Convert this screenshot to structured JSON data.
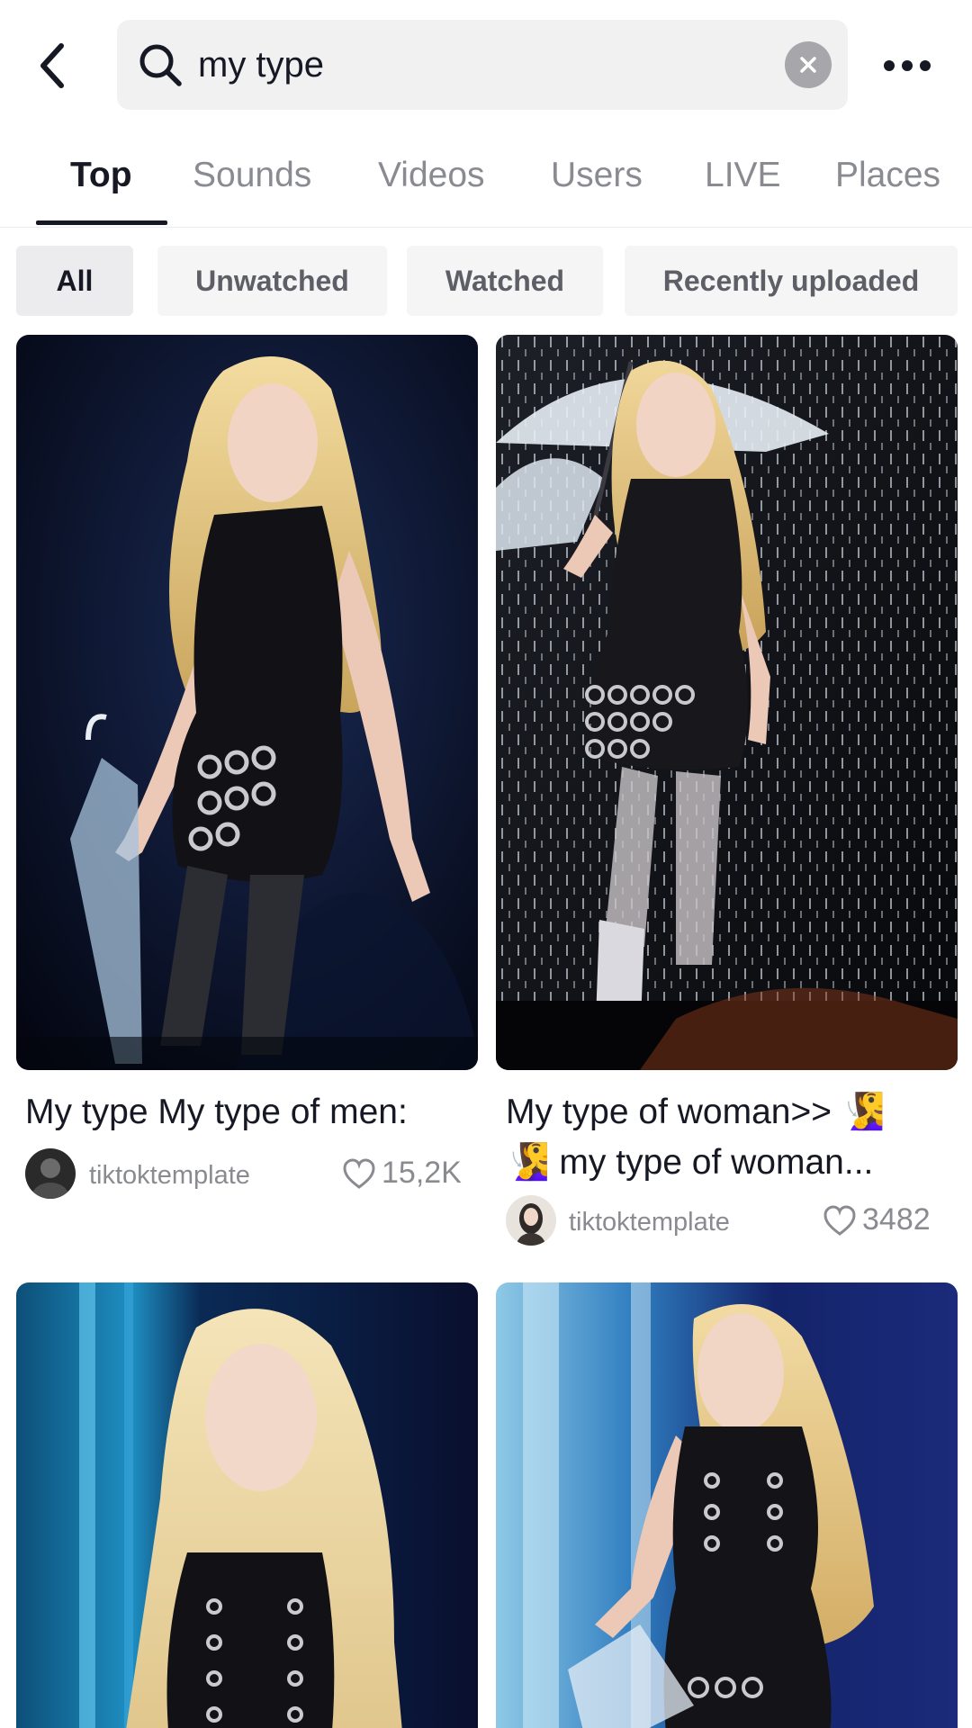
{
  "search": {
    "query": "my type"
  },
  "tabs": [
    {
      "label": "Top",
      "active": true
    },
    {
      "label": "Sounds",
      "active": false
    },
    {
      "label": "Videos",
      "active": false
    },
    {
      "label": "Users",
      "active": false
    },
    {
      "label": "LIVE",
      "active": false
    },
    {
      "label": "Places",
      "active": false
    }
  ],
  "filters": [
    {
      "label": "All",
      "active": true
    },
    {
      "label": "Unwatched",
      "active": false
    },
    {
      "label": "Watched",
      "active": false
    },
    {
      "label": "Recently uploaded",
      "active": false
    }
  ],
  "results": [
    {
      "title": "My type My type of men:",
      "emoji": "",
      "title_line2": "",
      "author": "tiktoktemplate",
      "likes": "15,2K",
      "image": "blonde performer in black leather outfit holding clear umbrella on dark stage"
    },
    {
      "title": "My type of woman>> ",
      "emoji": "🧏‍♀️",
      "title_line2": "my type of woman...",
      "author": "tiktoktemplate",
      "likes": "3482",
      "image": "blonde performer in black leather outfit holding clear umbrella in rain"
    },
    {
      "image": "blonde performer in black leather top on blue lit stage"
    },
    {
      "image": "blonde performer in black leather top holding umbrella on blue stage"
    }
  ],
  "colors": {
    "accent_text": "#161823",
    "muted_text": "#8a8b91",
    "search_bg": "#f1f1f2",
    "chip_bg": "#f5f5f6"
  },
  "icons": [
    "back-arrow-icon",
    "search-icon",
    "clear-icon",
    "more-icon",
    "heart-icon"
  ]
}
